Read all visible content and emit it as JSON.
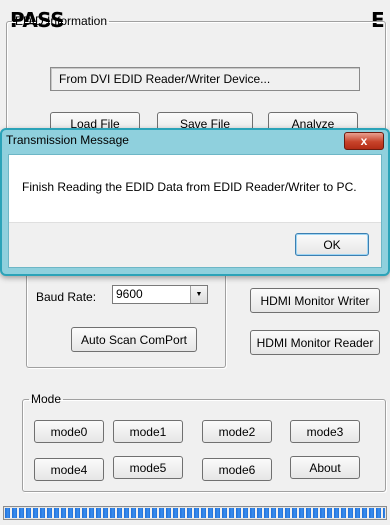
{
  "overlays": {
    "left": "PASS",
    "right": "E"
  },
  "edid_group": {
    "legend": "EDID Information",
    "status_text": "From DVI EDID Reader/Writer Device...",
    "load_button": "Load File",
    "save_button": "Save File",
    "analyze_button": "Analyze"
  },
  "comport": {
    "baud_label": "Baud Rate:",
    "baud_value": "9600",
    "auto_scan_button": "Auto Scan ComPort"
  },
  "hdmi": {
    "writer_button": "HDMI Monitor Writer",
    "reader_button": "HDMI Monitor Reader"
  },
  "mode_group": {
    "legend": "Mode",
    "buttons": [
      "mode0",
      "mode1",
      "mode2",
      "mode3",
      "mode4",
      "mode5",
      "mode6",
      "About"
    ]
  },
  "progress": {
    "value_percent": 100
  },
  "dialog": {
    "title": "Transmission Message",
    "close_label": "x",
    "message": "Finish Reading the EDID Data from EDID Reader/Writer to PC.",
    "ok_label": "OK"
  }
}
